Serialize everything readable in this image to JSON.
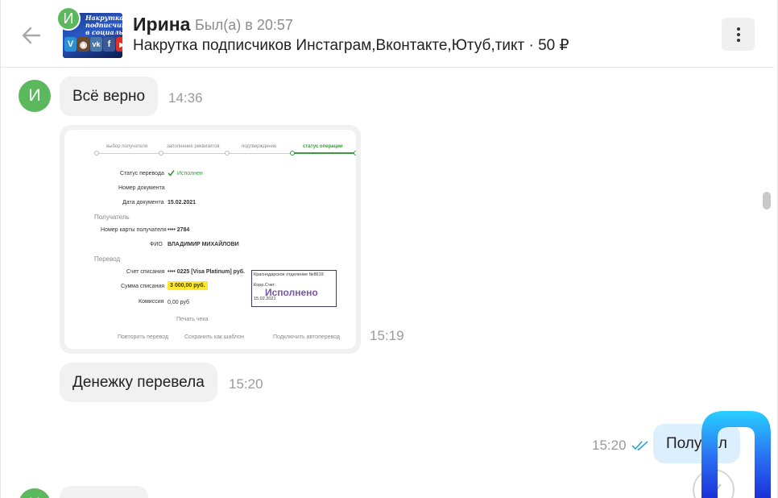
{
  "header": {
    "avatar_badge": "И",
    "avatar_lines": [
      "Накрутка лайков,",
      "подписчиков, друзей",
      "в социальные сети"
    ],
    "avatar_icons": [
      "V",
      "◉",
      "vk",
      "f",
      "▶"
    ],
    "name": "Ирина",
    "status": "Был(а) в 20:57",
    "subtitle": "Накрутка подписчиков Инстаграм,Вконтакте,Ютуб,тикт · 50 ₽"
  },
  "messages": {
    "m1": {
      "avatar": "И",
      "text": "Всё верно",
      "time": "14:36"
    },
    "m2": {
      "time": "15:19"
    },
    "m3": {
      "text": "Денежку перевела",
      "time": "15:20"
    },
    "m4": {
      "text": "Получил",
      "time": "15:20"
    },
    "m5": {
      "avatar": "И"
    }
  },
  "receipt": {
    "steps": [
      "выбор получателя",
      "заполнение реквизитов",
      "подтверждение",
      "статус операции"
    ],
    "status_label": "Статус перевода",
    "status_value": "Исполнен",
    "doc_number_label": "Номер документа",
    "doc_date_label": "Дата документа",
    "doc_date": "15.02.2021",
    "recipient_section": "Получатель",
    "card_label": "Номер карты получателя",
    "card_value": "•••• 2784",
    "fio_label": "ФИО",
    "fio_value": "ВЛАДИМИР МИХАЙЛОВИ",
    "transfer_section": "Перевод",
    "account_label": "Счет списания",
    "account_value": "•••• 0225  [Visa Platinum]  руб.",
    "amount_label": "Сумма списания",
    "amount_value": "3 000,00  руб.",
    "fee_label": "Комиссия",
    "fee_value": "0,00 руб",
    "print_label": "Печать чека",
    "repeat_label": "Повторить перевод",
    "save_label": "Сохранить как шаблон",
    "auto_label": "Подключить автоперевод",
    "stamp_branch": "Краснодарское отделение №8619",
    "stamp_account": "Корр.Счет:",
    "stamp_word": "Исполнено",
    "stamp_date": "15.02.2021"
  },
  "colors": {
    "accent_green": "#5cb85c",
    "outgoing_bubble": "#dcefff",
    "incoming_bubble": "#f1f1f1",
    "read_check": "#2aa3d6"
  }
}
